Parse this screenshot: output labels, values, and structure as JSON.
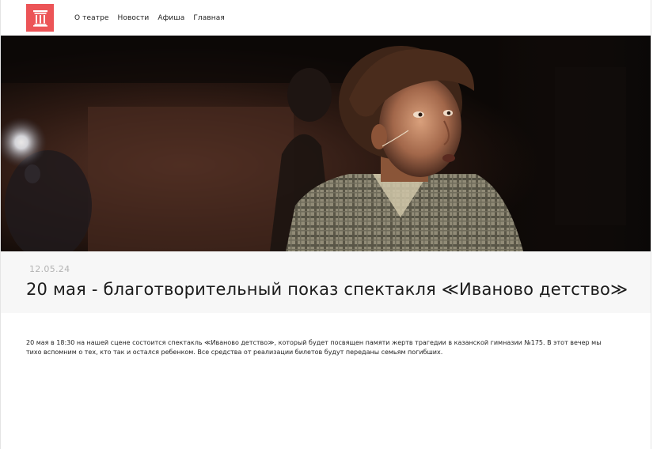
{
  "header": {
    "logo_icon": "theatre-column-icon",
    "logo_color": "#ec5457",
    "nav": [
      {
        "label": "О театре"
      },
      {
        "label": "Новости"
      },
      {
        "label": "Афиша"
      },
      {
        "label": "Главная"
      }
    ]
  },
  "article": {
    "date": "12.05.24",
    "title": "20 мая - благотворительный показ спектакля ≪Иваново детство≫",
    "body": "20 мая в 18:30 на нашей сцене состоится спектакль ≪Иваново детство≫, который будет посвящен памяти жертв трагедии в казанской гимназии №175. В этот вечер мы тихо вспомним о тех, кто так и остался ребенком. Все средства от реализации билетов будут переданы семьям погибших."
  }
}
